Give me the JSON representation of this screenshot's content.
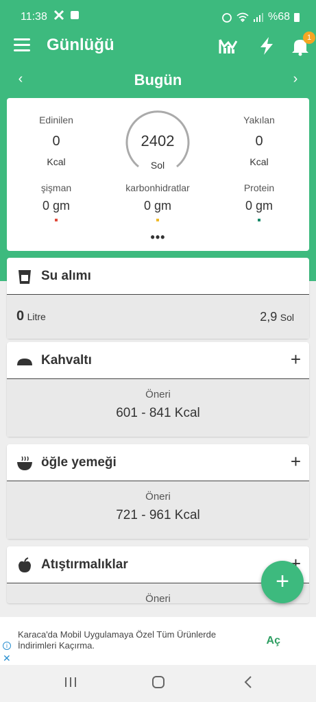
{
  "status": {
    "time": "11:38",
    "battery": "%68"
  },
  "header": {
    "title": "Günlüğü",
    "notification_count": "1"
  },
  "day": {
    "label": "Bugün",
    "prev": "‹",
    "next": "›"
  },
  "summary": {
    "eaten_label": "Edinilen",
    "eaten_value": "0",
    "eaten_unit": "Kcal",
    "burned_label": "Yakılan",
    "burned_value": "0",
    "burned_unit": "Kcal",
    "remaining_value": "2402",
    "remaining_label": "Sol",
    "macros": [
      {
        "label": "şişman",
        "value": "0 gm",
        "color": "#e04a3a"
      },
      {
        "label": "karbonhidratlar",
        "value": "0 gm",
        "color": "#f0b928"
      },
      {
        "label": "Protein",
        "value": "0 gm",
        "color": "#1b8a6b"
      }
    ],
    "more": "•••"
  },
  "water": {
    "title": "Su alımı",
    "amount": "0",
    "amount_unit": "Litre",
    "remaining": "2,9",
    "remaining_unit": "Sol"
  },
  "meals": [
    {
      "title": "Kahvaltı",
      "suggest_label": "Öneri",
      "kcal": "601 - 841 Kcal"
    },
    {
      "title": "öğle yemeği",
      "suggest_label": "Öneri",
      "kcal": "721 - 961 Kcal"
    },
    {
      "title": "Atıştırmalıklar",
      "suggest_label": "Öneri"
    }
  ],
  "fab": "+",
  "ad": {
    "text": "Karaca'da Mobil Uygulamaya Özel Tüm Ürünlerde İndirimleri Kaçırma.",
    "action": "Aç"
  },
  "colors": {
    "brand": "#3dba7e",
    "badge": "#f5a623"
  }
}
